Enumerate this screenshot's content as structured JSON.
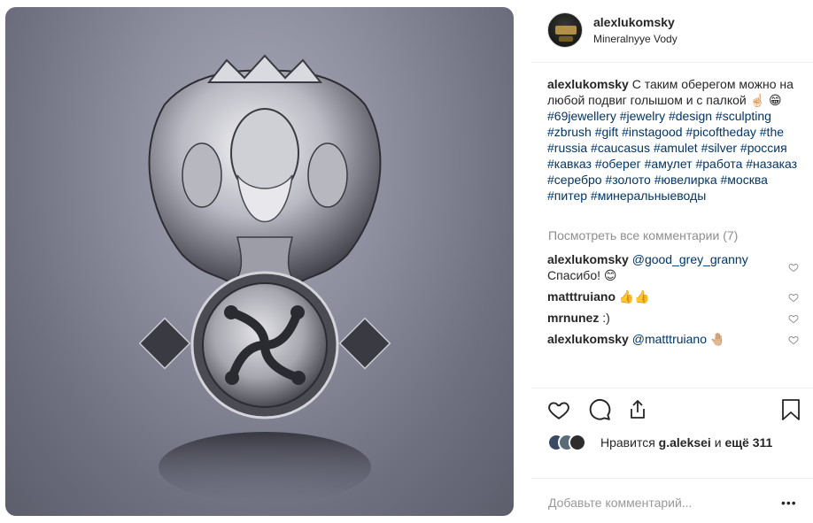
{
  "post": {
    "username": "alexlukomsky",
    "location": "Mineralnyye Vody",
    "media": {
      "image_description": ""
    }
  },
  "caption": {
    "username": "alexlukomsky",
    "text": "С таким оберегом можно на любой подвиг голышом и с палкой ☝🏻 😁",
    "hashtags": [
      "#69jewellery",
      "#jewelry",
      "#design",
      "#sculpting",
      "#zbrush",
      "#gift",
      "#instagood",
      "#picoftheday",
      "#the",
      "#russia",
      "#caucasus",
      "#amulet",
      "#silver",
      "#россия",
      "#кавказ",
      "#оберег",
      "#амулет",
      "#работа",
      "#назаказ",
      "#серебро",
      "#золото",
      "#ювелирка",
      "#москва",
      "#питер",
      "#минеральныеводы"
    ]
  },
  "view_all_comments": "Посмотреть все комментарии (7)",
  "comments": [
    {
      "user": "alexlukomsky",
      "mention": "@good_grey_granny",
      "text": "Спасибо! 😊"
    },
    {
      "user": "matttruiano",
      "mention": "",
      "text": "👍👍"
    },
    {
      "user": "mrnunez",
      "mention": "",
      "text": ":)"
    },
    {
      "user": "alexlukomsky",
      "mention": "@matttruiano",
      "text": "🤚🏼"
    }
  ],
  "actions": {
    "like_icon": "heart-icon",
    "comment_icon": "comment-bubble-icon",
    "share_icon": "share-icon",
    "save_icon": "bookmark-icon"
  },
  "likes": {
    "prefix": "Нравится ",
    "user": "g.aleksei",
    "middle": " и ",
    "count": "ещё 311"
  },
  "add_comment": {
    "placeholder": "Добавьте комментарий...",
    "more_label": "•••"
  },
  "colors": {
    "link": "#003569",
    "muted": "#8e8e8e",
    "text": "#262626"
  }
}
